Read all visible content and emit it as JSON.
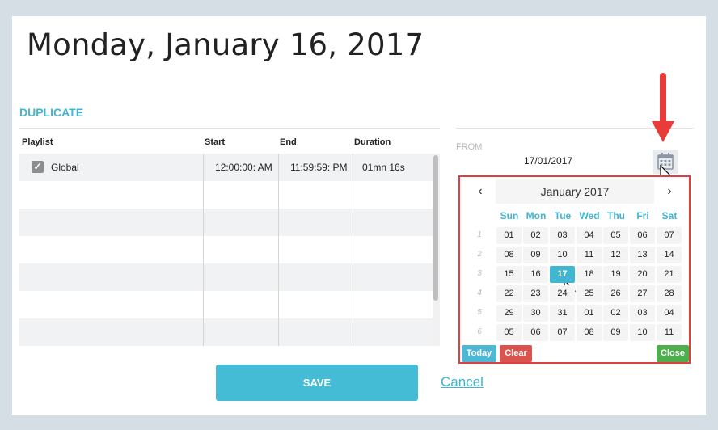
{
  "header": {
    "title": "Monday, January 16, 2017"
  },
  "section": {
    "title": "DUPLICATE"
  },
  "table": {
    "columns": [
      "Playlist",
      "Start",
      "End",
      "Duration"
    ],
    "rows": [
      {
        "checked": true,
        "playlist": "Global",
        "start": "12:00:00: AM",
        "end": "11:59:59: PM",
        "duration": "01mn 16s"
      }
    ]
  },
  "from": {
    "label": "FROM",
    "value": "17/01/2017",
    "icon": "calendar-icon"
  },
  "datepicker": {
    "month_label": "January 2017",
    "prev": "‹",
    "next": "›",
    "weekdays": [
      "Sun",
      "Mon",
      "Tue",
      "Wed",
      "Thu",
      "Fri",
      "Sat"
    ],
    "weeks": [
      {
        "num": "1",
        "days": [
          "01",
          "02",
          "03",
          "04",
          "05",
          "06",
          "07"
        ]
      },
      {
        "num": "2",
        "days": [
          "08",
          "09",
          "10",
          "11",
          "12",
          "13",
          "14"
        ]
      },
      {
        "num": "3",
        "days": [
          "15",
          "16",
          "17",
          "18",
          "19",
          "20",
          "21"
        ]
      },
      {
        "num": "4",
        "days": [
          "22",
          "23",
          "24",
          "25",
          "26",
          "27",
          "28"
        ]
      },
      {
        "num": "5",
        "days": [
          "29",
          "30",
          "31",
          "01",
          "02",
          "03",
          "04"
        ]
      },
      {
        "num": "6",
        "days": [
          "05",
          "06",
          "07",
          "08",
          "09",
          "10",
          "11"
        ]
      }
    ],
    "selected": "17",
    "today_label": "Today",
    "clear_label": "Clear",
    "close_label": "Close",
    "colors": {
      "today": "#4fb7d6",
      "clear": "#d9534f",
      "close": "#4cae4c",
      "accent": "#41b6d1",
      "highlight_border": "#e23e3e"
    }
  },
  "footer": {
    "save_label": "SAVE",
    "cancel_label": "Cancel"
  }
}
